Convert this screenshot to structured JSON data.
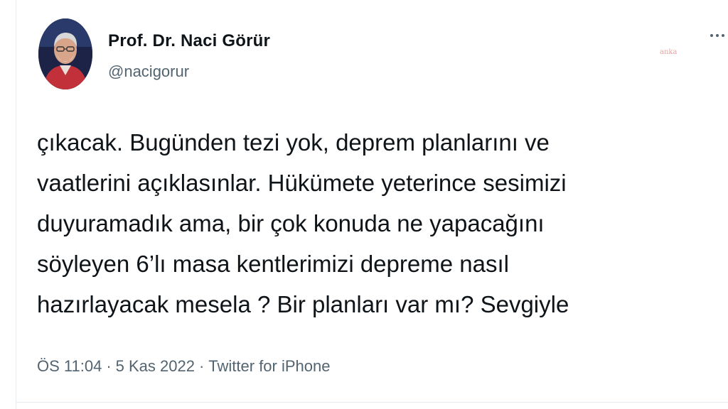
{
  "tweet": {
    "author": {
      "display_name": "Prof. Dr. Naci Görür",
      "handle": "@nacigorur",
      "avatar_icon": "profile-photo"
    },
    "more_icon": "ellipsis-icon",
    "watermark": "anka",
    "text": "çıkacak. Bugünden tezi yok, deprem planlarını ve\nvaatlerini açıklasınlar. Hükümete yeterince sesimizi\nduyuramadık ama, bir çok konuda ne yapacağını\nsöyleyen 6’lı masa kentlerimizi depreme nasıl\nhazırlayacak mesela ? Bir planları var mı? Sevgiyle",
    "time": "ÖS 11:04",
    "separator": "·",
    "date": "5 Kas 2022",
    "source": "Twitter for iPhone"
  },
  "colors": {
    "text_primary": "#0f1419",
    "text_secondary": "#536471",
    "border": "#e6ecf0"
  }
}
